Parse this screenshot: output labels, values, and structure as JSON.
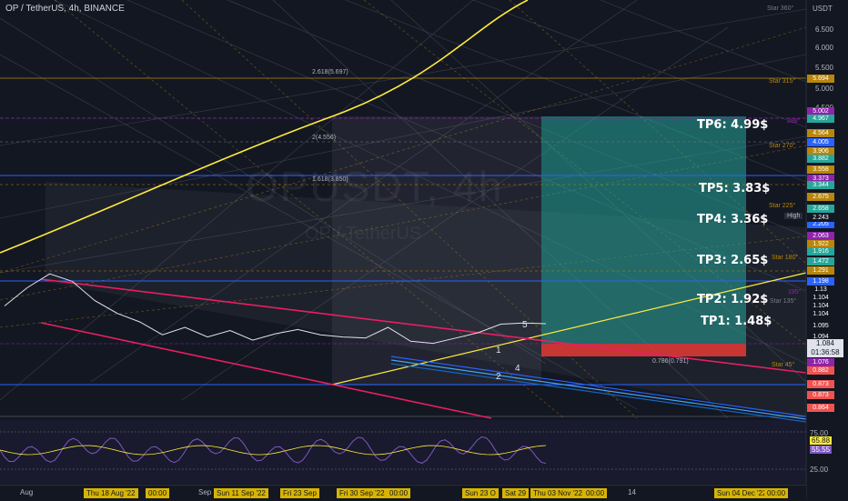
{
  "header": {
    "title": "OP / TetherUS, 4h, BINANCE",
    "currency": "USDT"
  },
  "watermark": {
    "symbol": "OPUSDT, 4h",
    "name": "OP / TetherUS"
  },
  "targets": [
    {
      "label": "TP6: 4.99$"
    },
    {
      "label": "TP5: 3.83$"
    },
    {
      "label": "TP4: 3.36$"
    },
    {
      "label": "TP3: 2.65$"
    },
    {
      "label": "TP2: 1.92$"
    },
    {
      "label": "TP1: 1.48$"
    }
  ],
  "fib_labels": [
    "2.618(5.697)",
    "2(4.556)",
    "1.618(3.850)",
    "0.786(0.791)"
  ],
  "price_axis": [
    "6.500",
    "6.000",
    "5.500",
    "5.000",
    "4.500"
  ],
  "price_tags": [
    {
      "v": "5.694",
      "c": "#b8860b"
    },
    {
      "v": "5.002",
      "c": "#8e24aa"
    },
    {
      "v": "4.967",
      "c": "#26a69a"
    },
    {
      "v": "4.564",
      "c": "#b8860b"
    },
    {
      "v": "4.005",
      "c": "#2962ff"
    },
    {
      "v": "3.906",
      "c": "#b8860b"
    },
    {
      "v": "3.882",
      "c": "#26a69a"
    },
    {
      "v": "3.558",
      "c": "#b8860b"
    },
    {
      "v": "3.373",
      "c": "#8e24aa"
    },
    {
      "v": "3.344",
      "c": "#26a69a"
    },
    {
      "v": "2.675",
      "c": "#b8860b"
    },
    {
      "v": "2.658",
      "c": "#26a69a"
    },
    {
      "v": "2.205",
      "c": "#2962ff"
    },
    {
      "v": "2.243",
      "c": "#131722"
    },
    {
      "v": "2.063",
      "c": "#8e24aa"
    },
    {
      "v": "1.922",
      "c": "#b8860b"
    },
    {
      "v": "1.916",
      "c": "#26a69a"
    },
    {
      "v": "1.472",
      "c": "#26a69a"
    },
    {
      "v": "1.291",
      "c": "#b8860b"
    },
    {
      "v": "1.198",
      "c": "#2962ff"
    },
    {
      "v": "1.13",
      "c": "#131722"
    },
    {
      "v": "1.104",
      "c": "#131722"
    },
    {
      "v": "1.104",
      "c": "#131722"
    },
    {
      "v": "1.104",
      "c": "#131722"
    },
    {
      "v": "1.095",
      "c": "#131722"
    },
    {
      "v": "1.094",
      "c": "#131722"
    },
    {
      "v": "1.076",
      "c": "#8e24aa"
    },
    {
      "v": "0.882",
      "c": "#ef5350"
    },
    {
      "v": "0.873",
      "c": "#ef5350"
    },
    {
      "v": "0.873",
      "c": "#ef5350"
    },
    {
      "v": "0.864",
      "c": "#ef5350"
    }
  ],
  "current_price": {
    "value": "1.084",
    "countdown": "01:36:58"
  },
  "high_label": "High",
  "star_labels": [
    "Star 360°",
    "Star 315°",
    "288°",
    "Star 270°",
    "Star 225°",
    "Star 180°",
    "195°",
    "Star 135°",
    "Star 45°"
  ],
  "wave_labels": [
    "5",
    "1",
    "2",
    "4"
  ],
  "rsi": {
    "levels": [
      "75.00",
      "65.88",
      "55.55",
      "25.00"
    ]
  },
  "time_axis": [
    {
      "label": "Aug",
      "hl": false
    },
    {
      "label": "Thu 18 Aug '22",
      "hl": true
    },
    {
      "label": "00:00",
      "hl": true
    },
    {
      "label": "Sep",
      "hl": false
    },
    {
      "label": "Sun 11 Sep '22",
      "hl": true
    },
    {
      "label": "Fri 23 Sep",
      "hl": true
    },
    {
      "label": "Fri 30 Sep '22",
      "hl": true
    },
    {
      "label": "00:00",
      "hl": true
    },
    {
      "label": "Sun 23 O",
      "hl": true
    },
    {
      "label": "Sat 29",
      "hl": true
    },
    {
      "label": "Thu 03 Nov '22",
      "hl": true
    },
    {
      "label": "00:00",
      "hl": true
    },
    {
      "label": "14",
      "hl": false
    },
    {
      "label": "Sun 04 Dec '22",
      "hl": true
    },
    {
      "label": "00:00",
      "hl": true
    }
  ],
  "chart_data": {
    "type": "line",
    "title": "OP / TetherUS, 4h, BINANCE",
    "series": [
      {
        "values": [
          1.25,
          1.42,
          1.55,
          1.48,
          1.3,
          1.18,
          1.1,
          0.98,
          1.05,
          0.96,
          1.02,
          0.93,
          0.99,
          1.03,
          0.98,
          0.96,
          0.95,
          1.05,
          0.92,
          0.9,
          0.95,
          1.0,
          1.08,
          1.09,
          1.084
        ]
      }
    ],
    "ylim": [
      0.8,
      7.0
    ],
    "xlabel": "",
    "ylabel": ""
  }
}
